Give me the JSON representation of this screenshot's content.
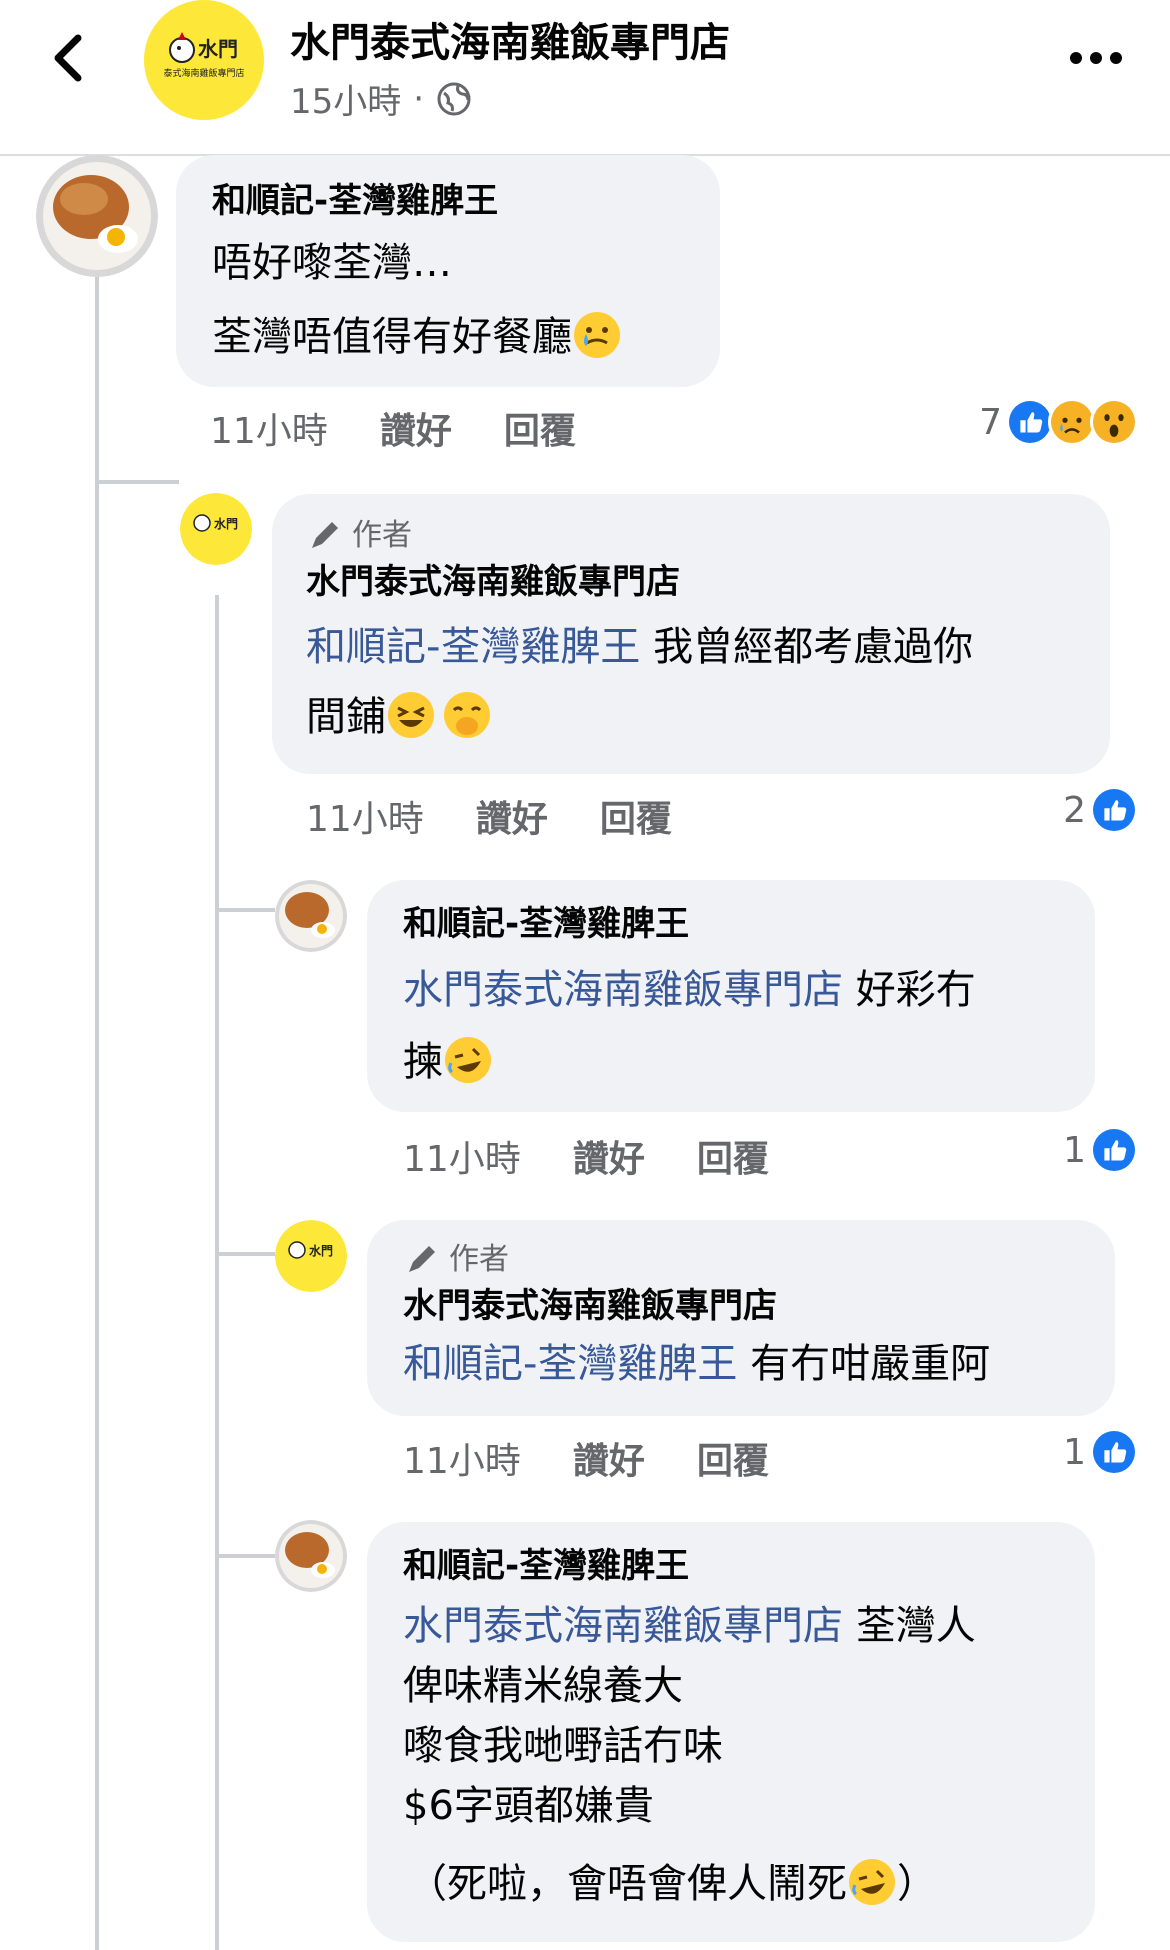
{
  "header": {
    "page_name": "水門泰式海南雞飯專門店",
    "time": "15小時",
    "separator": "·",
    "avatar_text_top": "水門",
    "avatar_text_bottom": "泰式海南雞飯專門店"
  },
  "comments": [
    {
      "author": "和順記-荃灣雞脾王",
      "line1": "唔好嚟荃灣…",
      "line2": "荃灣唔值得有好餐廳",
      "time": "11小時",
      "like": "讚好",
      "reply": "回覆",
      "reaction_count": "7"
    },
    {
      "author_tag": "作者",
      "author": "水門泰式海南雞飯專門店",
      "mention": "和順記-荃灣雞脾王",
      "text_a": " 我曾經都考慮過你",
      "text_b": "間鋪",
      "time": "11小時",
      "like": "讚好",
      "reply": "回覆",
      "reaction_count": "2"
    },
    {
      "author": "和順記-荃灣雞脾王",
      "mention": "水門泰式海南雞飯專門店",
      "text_a": " 好彩冇",
      "text_b": "揀",
      "time": "11小時",
      "like": "讚好",
      "reply": "回覆",
      "reaction_count": "1"
    },
    {
      "author_tag": "作者",
      "author": "水門泰式海南雞飯專門店",
      "mention": "和順記-荃灣雞脾王",
      "text_a": " 有冇咁嚴重阿",
      "time": "11小時",
      "like": "讚好",
      "reply": "回覆",
      "reaction_count": "1"
    },
    {
      "author": "和順記-荃灣雞脾王",
      "mention": "水門泰式海南雞飯專門店",
      "text_a": " 荃灣人",
      "line2": "俾味精米線養大",
      "line3": "嚟食我哋嘢話冇味",
      "line4": "$6字頭都嫌貴",
      "line5": "（死啦，會唔會俾人鬧死",
      "line5_end": "）"
    }
  ],
  "colors": {
    "accent": "#385898",
    "like_blue": "#1877f2",
    "bubble": "#f0f2f5",
    "meta": "#65676b",
    "avatar_yellow": "#fde83a"
  }
}
